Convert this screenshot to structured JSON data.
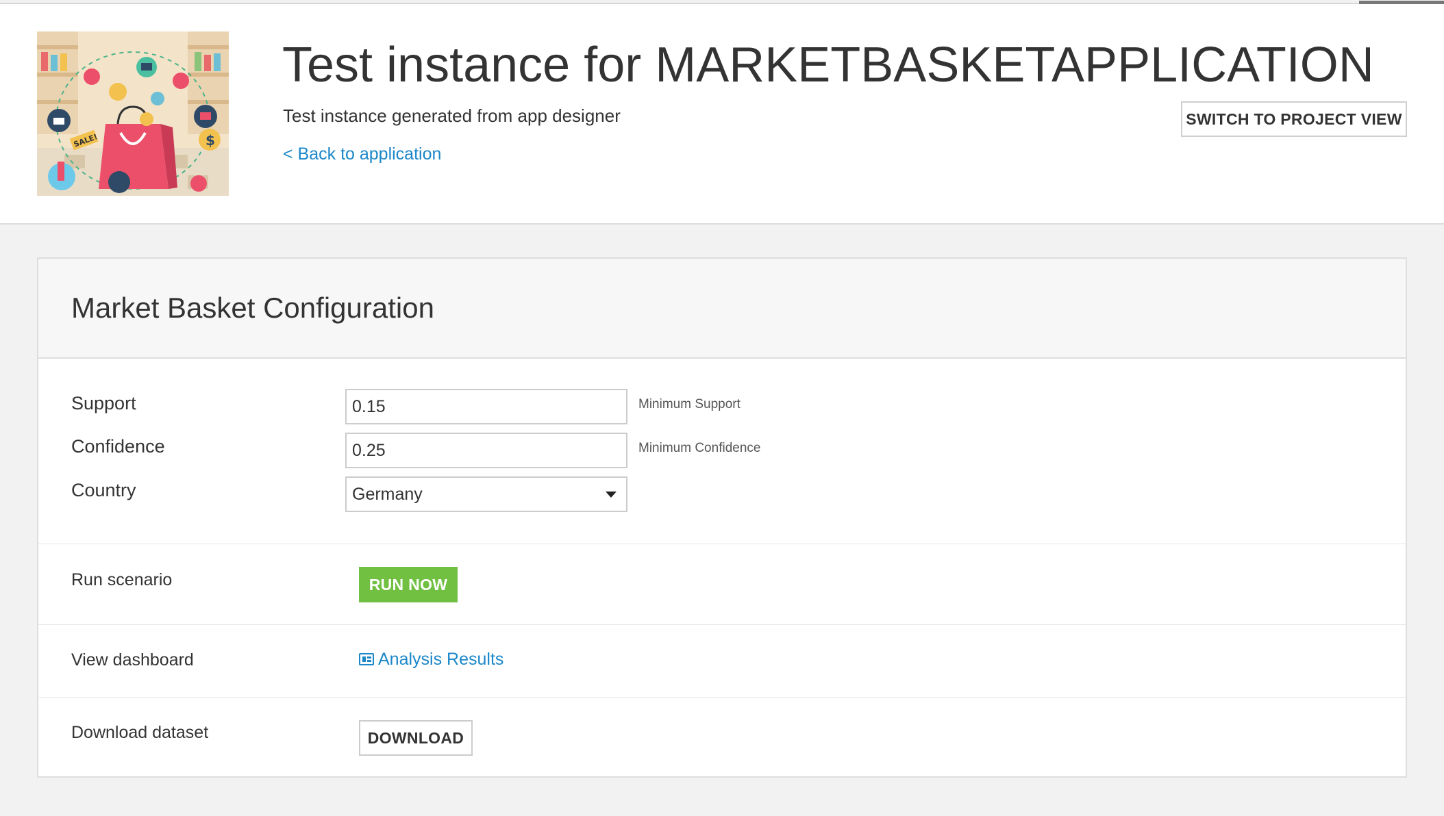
{
  "header": {
    "title": "Test instance for MARKETBASKETAPPLICATION",
    "subtitle": "Test instance generated from app designer",
    "back_link": "< Back to application",
    "switch_button": "SWITCH TO PROJECT VIEW",
    "image_sale_tag": "SALE!"
  },
  "panel": {
    "title": "Market Basket Configuration",
    "fields": {
      "support": {
        "label": "Support",
        "value": "0.15",
        "hint": "Minimum Support"
      },
      "confidence": {
        "label": "Confidence",
        "value": "0.25",
        "hint": "Minimum Confidence"
      },
      "country": {
        "label": "Country",
        "value": "Germany"
      }
    },
    "run": {
      "label": "Run scenario",
      "button": "RUN NOW"
    },
    "dashboard": {
      "label": "View dashboard",
      "link": "Analysis Results"
    },
    "download": {
      "label": "Download dataset",
      "button": "DOWNLOAD"
    }
  },
  "colors": {
    "link": "#1a87c9",
    "run_button": "#72c042",
    "background": "#f2f2f2"
  }
}
